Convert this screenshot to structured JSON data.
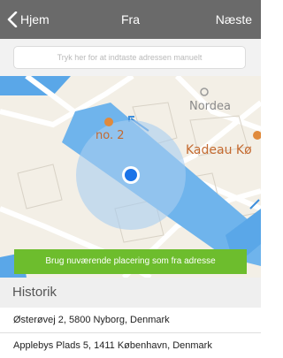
{
  "navbar": {
    "back_label": "Hjem",
    "title": "Fra",
    "next_label": "Næste"
  },
  "search": {
    "placeholder": "Tryk her for at indtaste adressen manuelt"
  },
  "map": {
    "labels": {
      "nordea": "Nordea",
      "no2": "no. 2",
      "kadeau": "Kadeau Kø"
    },
    "use_location_button": "Brug nuværende placering som fra adresse"
  },
  "history": {
    "header": "Historik",
    "items": [
      "Østerøvej 2, 5800 Nyborg, Denmark",
      "Applebys Plads 5, 1411 København, Denmark"
    ]
  },
  "colors": {
    "navbar": "#6a6a6a",
    "button_green": "#6dbd2d",
    "water": "#5aa7e8",
    "location_dot": "#1a73e8"
  }
}
